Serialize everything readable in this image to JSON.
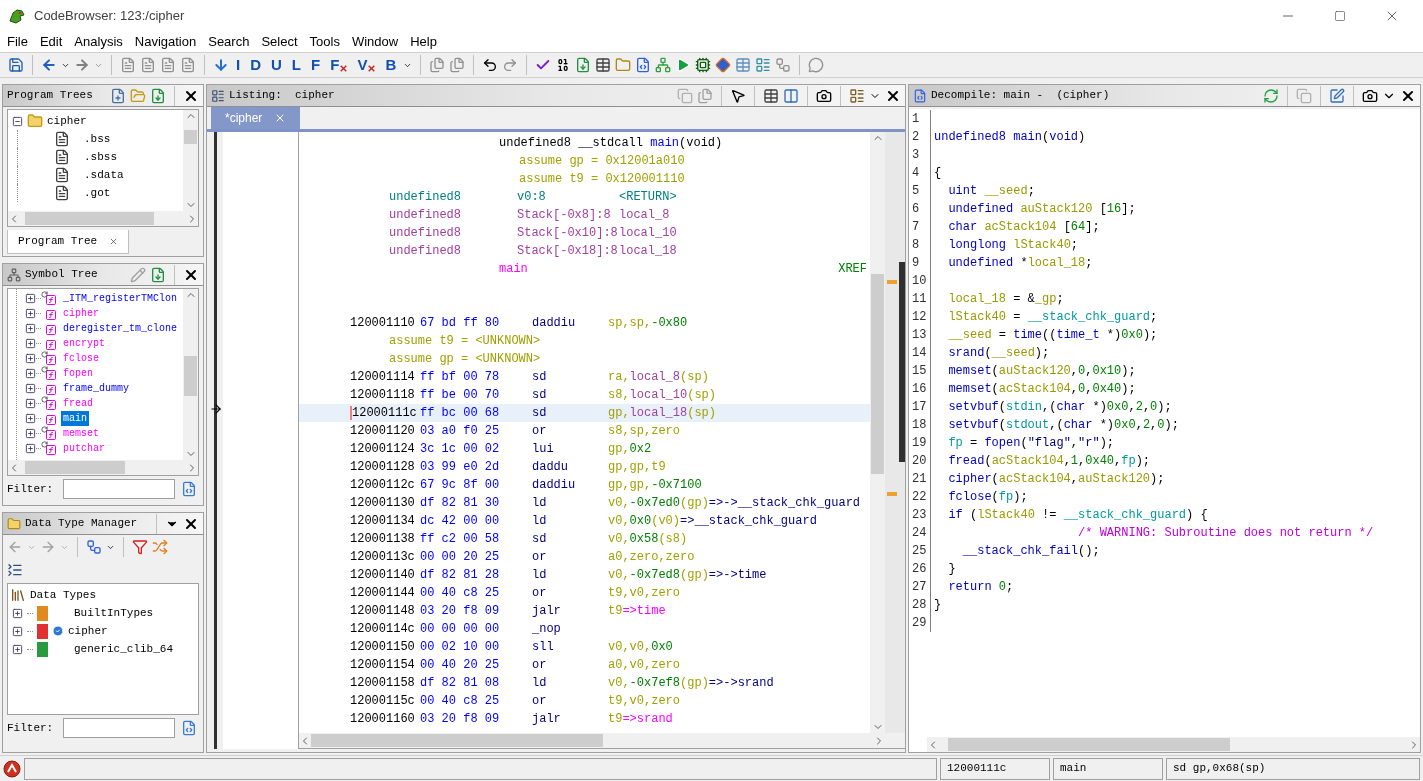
{
  "window": {
    "title": "CodeBrowser: 123:/cipher"
  },
  "menu": [
    "File",
    "Edit",
    "Analysis",
    "Navigation",
    "Search",
    "Select",
    "Tools",
    "Window",
    "Help"
  ],
  "toolbar_letters": [
    {
      "glyph": "I",
      "crossed": false
    },
    {
      "glyph": "D",
      "crossed": false
    },
    {
      "glyph": "U",
      "crossed": false
    },
    {
      "glyph": "L",
      "crossed": false
    },
    {
      "glyph": "F",
      "crossed": false
    },
    {
      "glyph": "F",
      "crossed": true
    },
    {
      "glyph": "V",
      "crossed": true
    },
    {
      "glyph": "B",
      "crossed": false
    }
  ],
  "program_trees": {
    "title": "Program Trees",
    "tree": [
      {
        "label": "cipher",
        "expanded": true,
        "children": [
          {
            "label": ".bss"
          },
          {
            "label": ".sbss"
          },
          {
            "label": ".sdata"
          },
          {
            "label": ".got"
          }
        ]
      }
    ],
    "tabs": [
      {
        "label": "Program Tree",
        "selected": true
      }
    ]
  },
  "symbol_tree": {
    "title": "Symbol Tree",
    "items": [
      {
        "label": "_ITM_registerTMClon",
        "external": false,
        "thunk": true,
        "selected": false
      },
      {
        "label": "cipher",
        "external": true,
        "thunk": false,
        "selected": false
      },
      {
        "label": "deregister_tm_clone",
        "external": false,
        "thunk": false,
        "selected": false
      },
      {
        "label": "encrypt",
        "external": true,
        "thunk": false,
        "selected": false
      },
      {
        "label": "fclose",
        "external": true,
        "thunk": true,
        "selected": false
      },
      {
        "label": "fopen",
        "external": true,
        "thunk": true,
        "selected": false
      },
      {
        "label": "frame_dummy",
        "external": false,
        "thunk": false,
        "selected": false
      },
      {
        "label": "fread",
        "external": true,
        "thunk": true,
        "selected": false
      },
      {
        "label": "main",
        "external": false,
        "thunk": false,
        "selected": true
      },
      {
        "label": "memset",
        "external": true,
        "thunk": true,
        "selected": false
      },
      {
        "label": "putchar",
        "external": true,
        "thunk": true,
        "selected": false
      }
    ],
    "filter": {
      "label": "Filter:"
    }
  },
  "data_type_manager": {
    "title": "Data Type Manager",
    "tree": [
      {
        "label": "Data Types",
        "children": [
          {
            "label": "BuiltInTypes",
            "color": "#e08a1e",
            "checked": false
          },
          {
            "label": "cipher",
            "color": "#e03030",
            "checked": true
          },
          {
            "label": "generic_clib_64",
            "color": "#2a9a40",
            "checked": false
          }
        ]
      }
    ],
    "filter": {
      "label": "Filter:"
    }
  },
  "listing": {
    "title": "Listing:  cipher",
    "tabs": [
      {
        "label": "*cipher",
        "selected": true
      }
    ],
    "rows": [
      {
        "kind": "signature",
        "tokens": [
          {
            "kind": "plain",
            "text": "undefined8 __stdcall "
          },
          {
            "kind": "function",
            "text": "main"
          },
          {
            "kind": "plain",
            "text": "(void)"
          }
        ]
      },
      {
        "kind": "assume",
        "tokens": [
          {
            "kind": "register",
            "text": "assume gp = 0x12001a010"
          }
        ]
      },
      {
        "kind": "assume",
        "tokens": [
          {
            "kind": "register",
            "text": "assume t9 = 0x120001110"
          }
        ]
      },
      {
        "kind": "param",
        "cells": [
          {
            "kind": "return",
            "text": "undefined8"
          },
          {
            "kind": "return",
            "text": "v0:8"
          },
          {
            "kind": "return",
            "text": "<RETURN>"
          }
        ]
      },
      {
        "kind": "param",
        "cells": [
          {
            "kind": "stack",
            "text": "undefined8"
          },
          {
            "kind": "stack",
            "text": "Stack[-0x8]:8"
          },
          {
            "kind": "stack",
            "text": "local_8"
          }
        ]
      },
      {
        "kind": "param",
        "cells": [
          {
            "kind": "stack",
            "text": "undefined8"
          },
          {
            "kind": "stack",
            "text": "Stack[-0x10]:8"
          },
          {
            "kind": "stack",
            "text": "local_10"
          }
        ]
      },
      {
        "kind": "param",
        "cells": [
          {
            "kind": "stack",
            "text": "undefined8"
          },
          {
            "kind": "stack",
            "text": "Stack[-0x18]:8"
          },
          {
            "kind": "stack",
            "text": "local_18"
          }
        ]
      },
      {
        "kind": "label",
        "name": "main",
        "xref": "XREF"
      },
      {
        "kind": "blank"
      },
      {
        "kind": "blank"
      },
      {
        "kind": "instr",
        "address": "120001110",
        "bytes": "67 bd ff 80",
        "mnemonic": "daddiu",
        "operands": [
          {
            "kind": "register",
            "text": "sp,sp,"
          },
          {
            "kind": "number",
            "text": "-0x80"
          }
        ],
        "selected": false
      },
      {
        "kind": "note",
        "tokens": [
          {
            "kind": "register",
            "text": "assume t9 = <UNKNOWN>"
          }
        ]
      },
      {
        "kind": "note",
        "tokens": [
          {
            "kind": "register",
            "text": "assume gp = <UNKNOWN>"
          }
        ]
      },
      {
        "kind": "instr",
        "address": "120001114",
        "bytes": "ff bf 00 78",
        "mnemonic": "sd",
        "operands": [
          {
            "kind": "register",
            "text": "ra,"
          },
          {
            "kind": "stack",
            "text": "local_8"
          },
          {
            "kind": "register",
            "text": "(sp)"
          }
        ],
        "selected": false
      },
      {
        "kind": "instr",
        "address": "120001118",
        "bytes": "ff be 00 70",
        "mnemonic": "sd",
        "operands": [
          {
            "kind": "register",
            "text": "s8,"
          },
          {
            "kind": "stack",
            "text": "local_10"
          },
          {
            "kind": "register",
            "text": "(sp)"
          }
        ],
        "selected": false
      },
      {
        "kind": "instr",
        "address": "12000111c",
        "bytes": "ff bc 00 68",
        "mnemonic": "sd",
        "operands": [
          {
            "kind": "register",
            "text": "gp,"
          },
          {
            "kind": "stack",
            "text": "local_18"
          },
          {
            "kind": "register",
            "text": "(sp)"
          }
        ],
        "selected": true
      },
      {
        "kind": "instr",
        "address": "120001120",
        "bytes": "03 a0 f0 25",
        "mnemonic": "or",
        "operands": [
          {
            "kind": "register",
            "text": "s8,sp,zero"
          }
        ],
        "selected": false
      },
      {
        "kind": "instr",
        "address": "120001124",
        "bytes": "3c 1c 00 02",
        "mnemonic": "lui",
        "operands": [
          {
            "kind": "register",
            "text": "gp,"
          },
          {
            "kind": "number",
            "text": "0x2"
          }
        ],
        "selected": false
      },
      {
        "kind": "instr",
        "address": "120001128",
        "bytes": "03 99 e0 2d",
        "mnemonic": "daddu",
        "operands": [
          {
            "kind": "register",
            "text": "gp,gp,t9"
          }
        ],
        "selected": false
      },
      {
        "kind": "instr",
        "address": "12000112c",
        "bytes": "67 9c 8f 00",
        "mnemonic": "daddiu",
        "operands": [
          {
            "kind": "register",
            "text": "gp,gp,"
          },
          {
            "kind": "number",
            "text": "-0x7100"
          }
        ],
        "selected": false
      },
      {
        "kind": "instr",
        "address": "120001130",
        "bytes": "df 82 81 30",
        "mnemonic": "ld",
        "operands": [
          {
            "kind": "register",
            "text": "v0,"
          },
          {
            "kind": "number",
            "text": "-0x7ed0"
          },
          {
            "kind": "register",
            "text": "(gp)"
          },
          {
            "kind": "symbol",
            "text": "=>->__stack_chk_guard"
          }
        ],
        "selected": false
      },
      {
        "kind": "instr",
        "address": "120001134",
        "bytes": "dc 42 00 00",
        "mnemonic": "ld",
        "operands": [
          {
            "kind": "register",
            "text": "v0,"
          },
          {
            "kind": "number",
            "text": "0x0"
          },
          {
            "kind": "register",
            "text": "(v0)"
          },
          {
            "kind": "symbol",
            "text": "=>__stack_chk_guard"
          }
        ],
        "selected": false
      },
      {
        "kind": "instr",
        "address": "120001138",
        "bytes": "ff c2 00 58",
        "mnemonic": "sd",
        "operands": [
          {
            "kind": "register",
            "text": "v0,"
          },
          {
            "kind": "number",
            "text": "0x58"
          },
          {
            "kind": "register",
            "text": "(s8)"
          }
        ],
        "selected": false
      },
      {
        "kind": "instr",
        "address": "12000113c",
        "bytes": "00 00 20 25",
        "mnemonic": "or",
        "operands": [
          {
            "kind": "register",
            "text": "a0,zero,zero"
          }
        ],
        "selected": false
      },
      {
        "kind": "instr",
        "address": "120001140",
        "bytes": "df 82 81 28",
        "mnemonic": "ld",
        "operands": [
          {
            "kind": "register",
            "text": "v0,"
          },
          {
            "kind": "number",
            "text": "-0x7ed8"
          },
          {
            "kind": "register",
            "text": "(gp)"
          },
          {
            "kind": "symbol",
            "text": "=>->time"
          }
        ],
        "selected": false
      },
      {
        "kind": "instr",
        "address": "120001144",
        "bytes": "00 40 c8 25",
        "mnemonic": "or",
        "operands": [
          {
            "kind": "register",
            "text": "t9,v0,zero"
          }
        ],
        "selected": false
      },
      {
        "kind": "instr",
        "address": "120001148",
        "bytes": "03 20 f8 09",
        "mnemonic": "jalr",
        "operands": [
          {
            "kind": "register",
            "text": "t9"
          },
          {
            "kind": "call",
            "text": "=>time"
          }
        ],
        "selected": false
      },
      {
        "kind": "instr",
        "address": "12000114c",
        "bytes": "00 00 00 00",
        "mnemonic": "_nop",
        "selected": false
      },
      {
        "kind": "instr",
        "address": "120001150",
        "bytes": "00 02 10 00",
        "mnemonic": "sll",
        "operands": [
          {
            "kind": "register",
            "text": "v0,v0,"
          },
          {
            "kind": "number",
            "text": "0x0"
          }
        ],
        "selected": false
      },
      {
        "kind": "instr",
        "address": "120001154",
        "bytes": "00 40 20 25",
        "mnemonic": "or",
        "operands": [
          {
            "kind": "register",
            "text": "a0,v0,zero"
          }
        ],
        "selected": false
      },
      {
        "kind": "instr",
        "address": "120001158",
        "bytes": "df 82 81 08",
        "mnemonic": "ld",
        "operands": [
          {
            "kind": "register",
            "text": "v0,"
          },
          {
            "kind": "number",
            "text": "-0x7ef8"
          },
          {
            "kind": "register",
            "text": "(gp)"
          },
          {
            "kind": "symbol",
            "text": "=>->srand"
          }
        ],
        "selected": false
      },
      {
        "kind": "instr",
        "address": "12000115c",
        "bytes": "00 40 c8 25",
        "mnemonic": "or",
        "operands": [
          {
            "kind": "register",
            "text": "t9,v0,zero"
          }
        ],
        "selected": false
      },
      {
        "kind": "instr",
        "address": "120001160",
        "bytes": "03 20 f8 09",
        "mnemonic": "jalr",
        "operands": [
          {
            "kind": "register",
            "text": "t9"
          },
          {
            "kind": "call",
            "text": "=>srand"
          }
        ],
        "selected": false
      }
    ]
  },
  "decompile": {
    "title": "Decompile: main -  (cipher)",
    "lines": [
      {
        "number": "1"
      },
      {
        "number": "2",
        "tokens": [
          {
            "kind": "keyword",
            "text": "undefined8 main"
          },
          {
            "kind": "plain",
            "text": "("
          },
          {
            "kind": "keyword",
            "text": "void"
          },
          {
            "kind": "plain",
            "text": ")"
          }
        ]
      },
      {
        "number": "3"
      },
      {
        "number": "4",
        "tokens": [
          {
            "kind": "plain",
            "text": "{"
          }
        ]
      },
      {
        "number": "5",
        "tokens": [
          {
            "kind": "keyword",
            "text": "  uint "
          },
          {
            "kind": "variable",
            "text": "__seed"
          },
          {
            "kind": "plain",
            "text": ";"
          }
        ]
      },
      {
        "number": "6",
        "tokens": [
          {
            "kind": "keyword",
            "text": "  undefined "
          },
          {
            "kind": "variable",
            "text": "auStack120"
          },
          {
            "kind": "plain",
            "text": " ["
          },
          {
            "kind": "number",
            "text": "16"
          },
          {
            "kind": "plain",
            "text": "];"
          }
        ]
      },
      {
        "number": "7",
        "tokens": [
          {
            "kind": "keyword",
            "text": "  char "
          },
          {
            "kind": "variable",
            "text": "acStack104"
          },
          {
            "kind": "plain",
            "text": " ["
          },
          {
            "kind": "number",
            "text": "64"
          },
          {
            "kind": "plain",
            "text": "];"
          }
        ]
      },
      {
        "number": "8",
        "tokens": [
          {
            "kind": "keyword",
            "text": "  longlong "
          },
          {
            "kind": "variable",
            "text": "lStack40"
          },
          {
            "kind": "plain",
            "text": ";"
          }
        ]
      },
      {
        "number": "9",
        "tokens": [
          {
            "kind": "keyword",
            "text": "  undefined "
          },
          {
            "kind": "plain",
            "text": "*"
          },
          {
            "kind": "variable",
            "text": "local_18"
          },
          {
            "kind": "plain",
            "text": ";"
          }
        ]
      },
      {
        "number": "10"
      },
      {
        "number": "11",
        "tokens": [
          {
            "kind": "variable",
            "text": "  local_18"
          },
          {
            "kind": "plain",
            "text": " = &"
          },
          {
            "kind": "variable",
            "text": "_gp"
          },
          {
            "kind": "plain",
            "text": ";"
          }
        ]
      },
      {
        "number": "12",
        "tokens": [
          {
            "kind": "variable",
            "text": "  lStack40"
          },
          {
            "kind": "plain",
            "text": " = "
          },
          {
            "kind": "global",
            "text": "__stack_chk_guard"
          },
          {
            "kind": "plain",
            "text": ";"
          }
        ]
      },
      {
        "number": "13",
        "tokens": [
          {
            "kind": "variable",
            "text": "  __seed"
          },
          {
            "kind": "plain",
            "text": " = "
          },
          {
            "kind": "keyword",
            "text": "time"
          },
          {
            "kind": "plain",
            "text": "(("
          },
          {
            "kind": "keyword",
            "text": "time_t"
          },
          {
            "kind": "plain",
            "text": " *)"
          },
          {
            "kind": "number",
            "text": "0x0"
          },
          {
            "kind": "plain",
            "text": ");"
          }
        ]
      },
      {
        "number": "14",
        "tokens": [
          {
            "kind": "keyword",
            "text": "  srand"
          },
          {
            "kind": "plain",
            "text": "("
          },
          {
            "kind": "variable",
            "text": "__seed"
          },
          {
            "kind": "plain",
            "text": ");"
          }
        ]
      },
      {
        "number": "15",
        "tokens": [
          {
            "kind": "keyword",
            "text": "  memset"
          },
          {
            "kind": "plain",
            "text": "("
          },
          {
            "kind": "variable",
            "text": "auStack120"
          },
          {
            "kind": "plain",
            "text": ","
          },
          {
            "kind": "number",
            "text": "0"
          },
          {
            "kind": "plain",
            "text": ","
          },
          {
            "kind": "number",
            "text": "0x10"
          },
          {
            "kind": "plain",
            "text": ");"
          }
        ]
      },
      {
        "number": "16",
        "tokens": [
          {
            "kind": "keyword",
            "text": "  memset"
          },
          {
            "kind": "plain",
            "text": "("
          },
          {
            "kind": "variable",
            "text": "acStack104"
          },
          {
            "kind": "plain",
            "text": ","
          },
          {
            "kind": "number",
            "text": "0"
          },
          {
            "kind": "plain",
            "text": ","
          },
          {
            "kind": "number",
            "text": "0x40"
          },
          {
            "kind": "plain",
            "text": ");"
          }
        ]
      },
      {
        "number": "17",
        "tokens": [
          {
            "kind": "keyword",
            "text": "  setvbuf"
          },
          {
            "kind": "plain",
            "text": "("
          },
          {
            "kind": "global",
            "text": "stdin"
          },
          {
            "kind": "plain",
            "text": ",("
          },
          {
            "kind": "keyword",
            "text": "char"
          },
          {
            "kind": "plain",
            "text": " *)"
          },
          {
            "kind": "number",
            "text": "0x0"
          },
          {
            "kind": "plain",
            "text": ","
          },
          {
            "kind": "number",
            "text": "2"
          },
          {
            "kind": "plain",
            "text": ","
          },
          {
            "kind": "number",
            "text": "0"
          },
          {
            "kind": "plain",
            "text": ");"
          }
        ]
      },
      {
        "number": "18",
        "tokens": [
          {
            "kind": "keyword",
            "text": "  setvbuf"
          },
          {
            "kind": "plain",
            "text": "("
          },
          {
            "kind": "global",
            "text": "stdout"
          },
          {
            "kind": "plain",
            "text": ",("
          },
          {
            "kind": "keyword",
            "text": "char"
          },
          {
            "kind": "plain",
            "text": " *)"
          },
          {
            "kind": "number",
            "text": "0x0"
          },
          {
            "kind": "plain",
            "text": ","
          },
          {
            "kind": "number",
            "text": "2"
          },
          {
            "kind": "plain",
            "text": ","
          },
          {
            "kind": "number",
            "text": "0"
          },
          {
            "kind": "plain",
            "text": ");"
          }
        ]
      },
      {
        "number": "19",
        "tokens": [
          {
            "kind": "global",
            "text": "  fp"
          },
          {
            "kind": "plain",
            "text": " = "
          },
          {
            "kind": "keyword",
            "text": "fopen"
          },
          {
            "kind": "plain",
            "text": "("
          },
          {
            "kind": "string",
            "text": "\"flag\""
          },
          {
            "kind": "plain",
            "text": ","
          },
          {
            "kind": "string",
            "text": "\"r\""
          },
          {
            "kind": "plain",
            "text": ");"
          }
        ]
      },
      {
        "number": "20",
        "tokens": [
          {
            "kind": "keyword",
            "text": "  fread"
          },
          {
            "kind": "plain",
            "text": "("
          },
          {
            "kind": "variable",
            "text": "acStack104"
          },
          {
            "kind": "plain",
            "text": ","
          },
          {
            "kind": "number",
            "text": "1"
          },
          {
            "kind": "plain",
            "text": ","
          },
          {
            "kind": "number",
            "text": "0x40"
          },
          {
            "kind": "plain",
            "text": ","
          },
          {
            "kind": "global",
            "text": "fp"
          },
          {
            "kind": "plain",
            "text": ");"
          }
        ]
      },
      {
        "number": "21",
        "tokens": [
          {
            "kind": "keyword",
            "text": "  cipher"
          },
          {
            "kind": "plain",
            "text": "("
          },
          {
            "kind": "variable",
            "text": "acStack104"
          },
          {
            "kind": "plain",
            "text": ","
          },
          {
            "kind": "variable",
            "text": "auStack120"
          },
          {
            "kind": "plain",
            "text": ");"
          }
        ]
      },
      {
        "number": "22",
        "tokens": [
          {
            "kind": "keyword",
            "text": "  fclose"
          },
          {
            "kind": "plain",
            "text": "("
          },
          {
            "kind": "global",
            "text": "fp"
          },
          {
            "kind": "plain",
            "text": ");"
          }
        ]
      },
      {
        "number": "23",
        "tokens": [
          {
            "kind": "keyword",
            "text": "  if"
          },
          {
            "kind": "plain",
            "text": " ("
          },
          {
            "kind": "variable",
            "text": "lStack40"
          },
          {
            "kind": "plain",
            "text": " != "
          },
          {
            "kind": "global",
            "text": "__stack_chk_guard"
          },
          {
            "kind": "plain",
            "text": ") {"
          }
        ]
      },
      {
        "number": "24",
        "tokens": [
          {
            "kind": "comment",
            "text": "                    /* WARNING: Subroutine does not return */"
          }
        ]
      },
      {
        "number": "25",
        "tokens": [
          {
            "kind": "keyword",
            "text": "    __stack_chk_fail"
          },
          {
            "kind": "plain",
            "text": "();"
          }
        ]
      },
      {
        "number": "26",
        "tokens": [
          {
            "kind": "plain",
            "text": "  }"
          }
        ]
      },
      {
        "number": "27",
        "tokens": [
          {
            "kind": "keyword",
            "text": "  return "
          },
          {
            "kind": "number",
            "text": "0"
          },
          {
            "kind": "plain",
            "text": ";"
          }
        ]
      },
      {
        "number": "28",
        "tokens": [
          {
            "kind": "plain",
            "text": "}"
          }
        ]
      },
      {
        "number": "29"
      }
    ]
  },
  "status_bar": {
    "fields": [
      "12000111c",
      "main",
      "sd gp,0x68(sp)"
    ]
  }
}
